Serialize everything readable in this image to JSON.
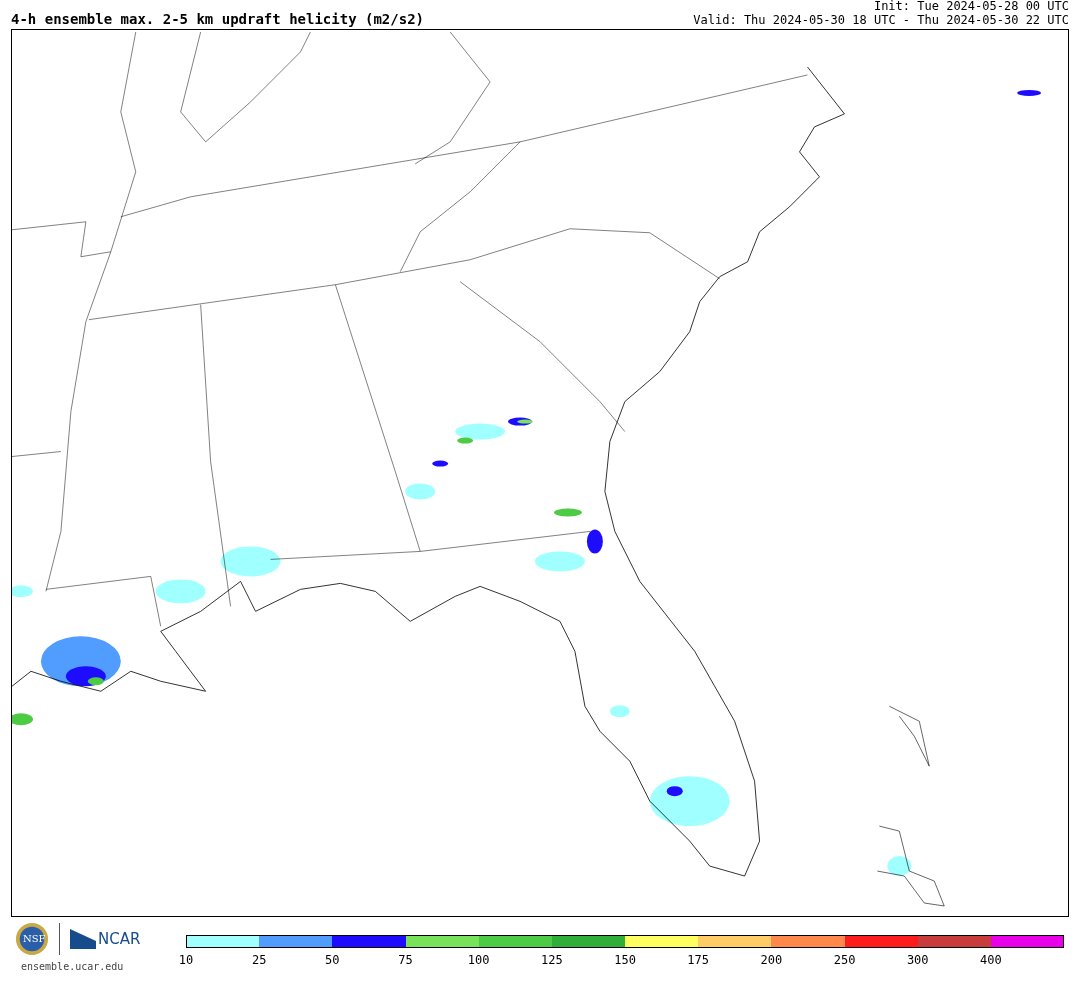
{
  "title": "4-h ensemble max. 2-5 km updraft helicity (m2/s2)",
  "init": "Init: Tue 2024-05-28 00 UTC",
  "valid": "Valid: Thu 2024-05-30 18 UTC - Thu 2024-05-30 22 UTC",
  "logos": {
    "seal_text": "NSF",
    "name": "NCAR",
    "url": "ensemble.ucar.edu"
  },
  "colorbar": [
    {
      "label": "10",
      "color": "#a0ffff"
    },
    {
      "label": "25",
      "color": "#509cff"
    },
    {
      "label": "50",
      "color": "#1e0cff"
    },
    {
      "label": "75",
      "color": "#78e25a"
    },
    {
      "label": "100",
      "color": "#4ecb44"
    },
    {
      "label": "125",
      "color": "#2fae3a"
    },
    {
      "label": "150",
      "color": "#ffff60"
    },
    {
      "label": "175",
      "color": "#ffcc66"
    },
    {
      "label": "200",
      "color": "#ff884a"
    },
    {
      "label": "250",
      "color": "#ff1c1c"
    },
    {
      "label": "300",
      "color": "#c83c3c"
    },
    {
      "label": "400",
      "color": "#e800e8"
    }
  ]
}
